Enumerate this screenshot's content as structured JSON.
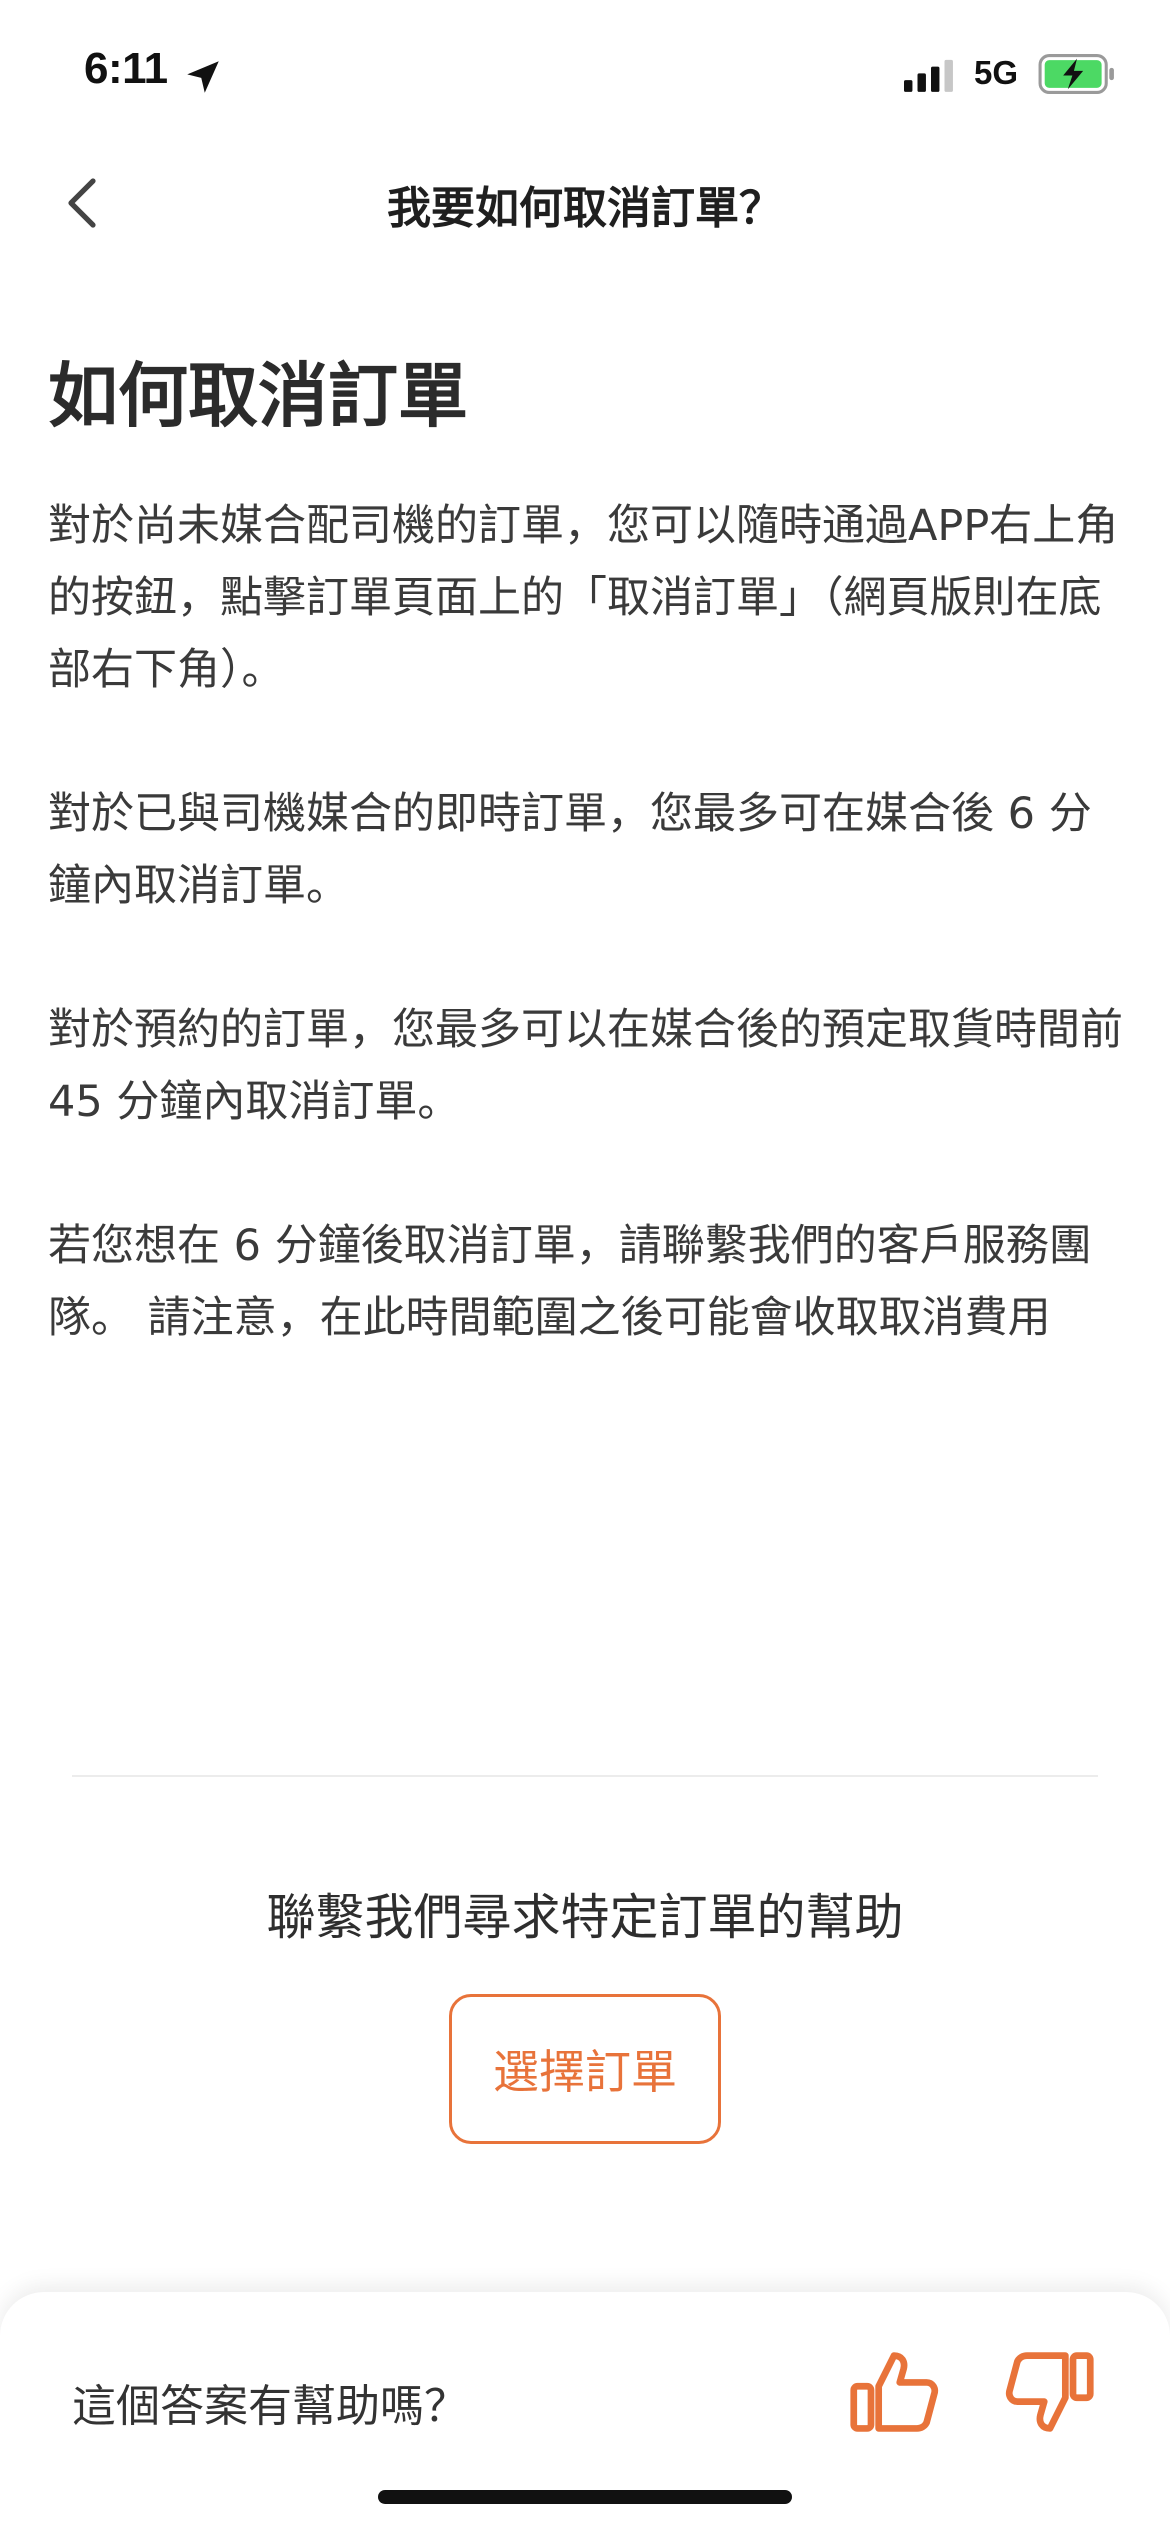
{
  "status_bar": {
    "time": "6:11",
    "network": "5G",
    "battery_color": "#4cd964"
  },
  "nav": {
    "title": "我要如何取消訂單？"
  },
  "article": {
    "title": "如何取消訂單",
    "paragraphs": [
      "對於尚未媒合配司機的訂單，您可以隨時通過APP右上角的按鈕，點擊訂單頁面上的「取消訂單」（網頁版則在底部右下角）。",
      "對於已與司機媒合的即時訂單，您最多可在媒合後 6 分鐘內取消訂單。",
      "對於預約的訂單，您最多可以在媒合後的預定取貨時間前 45 分鐘內取消訂單。",
      "若您想在 6 分鐘後取消訂單，請聯繫我們的客戶服務團隊。 請注意，在此時間範圍之後可能會收取取消費用"
    ]
  },
  "help": {
    "heading": "聯繫我們尋求特定訂單的幫助",
    "select_order_label": "選擇訂單"
  },
  "feedback": {
    "question": "這個答案有幫助嗎？"
  },
  "colors": {
    "accent": "#e8733a"
  }
}
